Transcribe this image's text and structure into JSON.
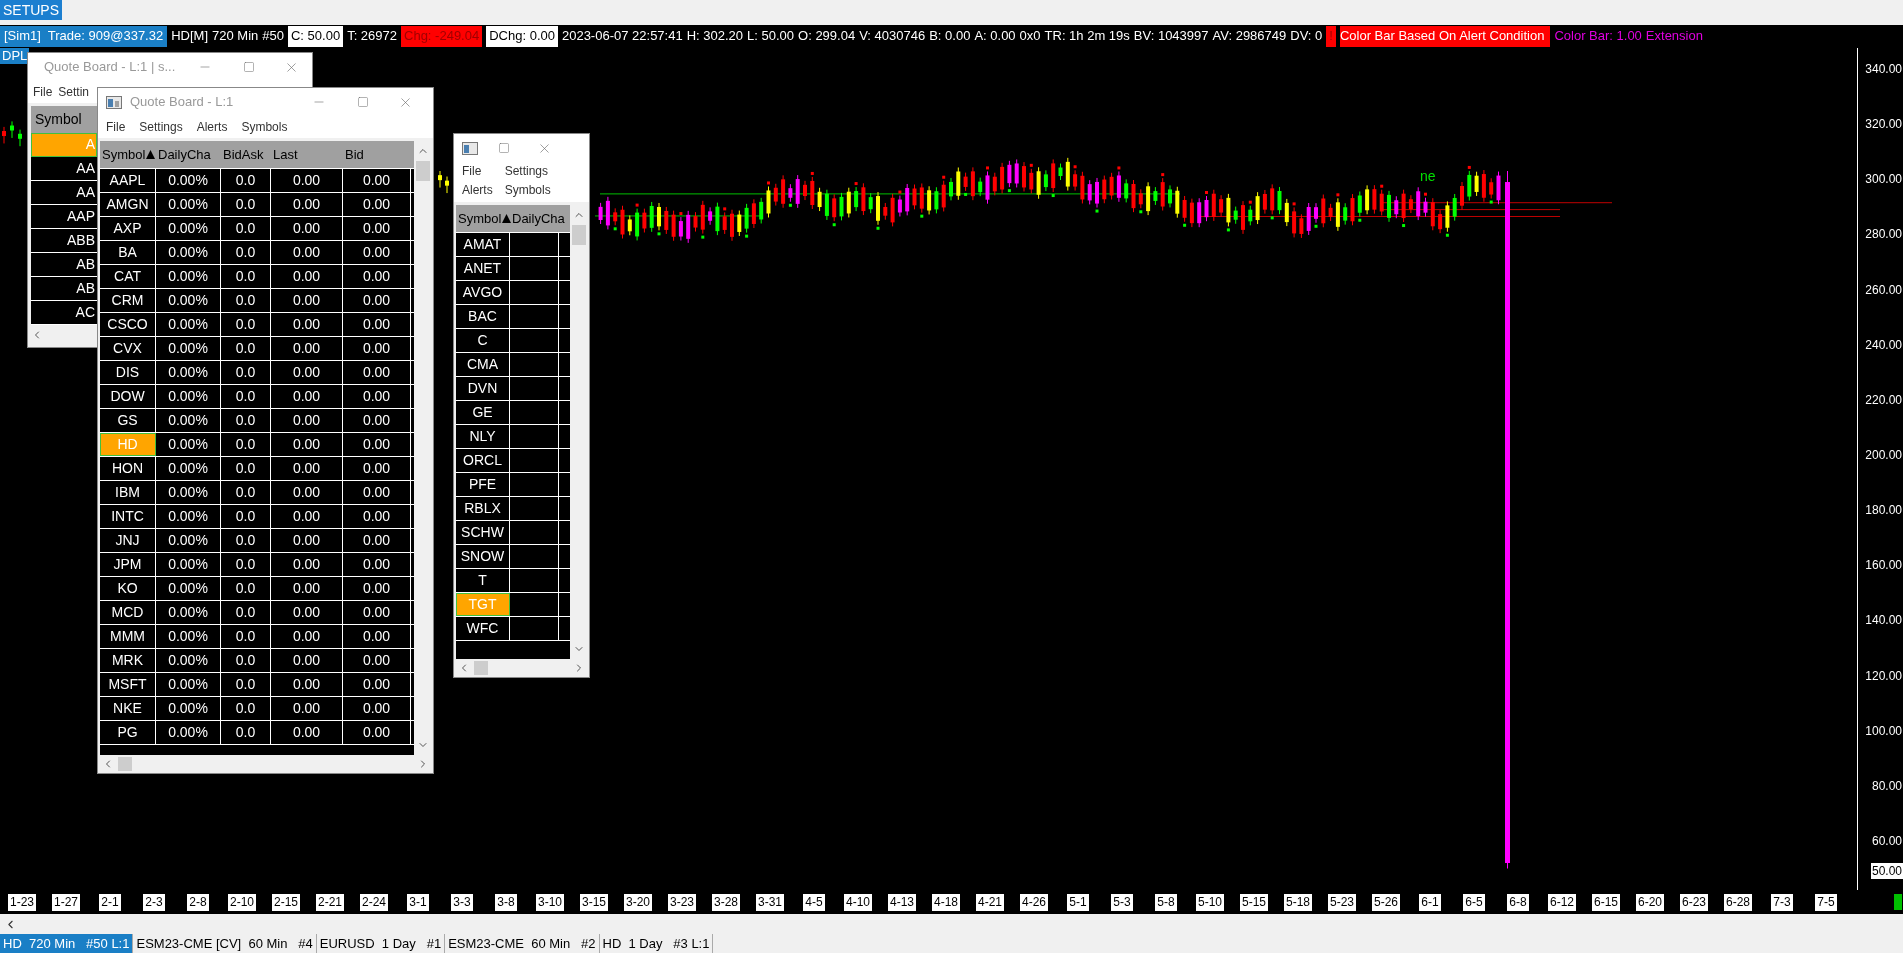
{
  "setups_button": "SETUPS",
  "info_bar": [
    {
      "text": "[Sim1]  Trade: 909@337.32",
      "kind": "account"
    },
    {
      "text": "HD[M]",
      "kind": "plain"
    },
    {
      "text": "720 Min",
      "kind": "plain"
    },
    {
      "text": "#50",
      "kind": "plain"
    },
    {
      "text": "C: 50.00",
      "kind": "boxed"
    },
    {
      "text": "T: 26972",
      "kind": "plain"
    },
    {
      "text": "Chg: -249.04",
      "kind": "alert"
    },
    {
      "text": "DChg: 0.00",
      "kind": "boxed"
    },
    {
      "text": "2023-06-07 22:57:41",
      "kind": "plain"
    },
    {
      "text": "H: 302.20",
      "kind": "plain"
    },
    {
      "text": "L: 50.00",
      "kind": "plain"
    },
    {
      "text": "O: 299.04",
      "kind": "plain"
    },
    {
      "text": "V: 4030746",
      "kind": "plain"
    },
    {
      "text": "B: 0.00",
      "kind": "plain"
    },
    {
      "text": "A: 0.00",
      "kind": "plain"
    },
    {
      "text": "0x0",
      "kind": "plain"
    },
    {
      "text": "TR: 1h 2m 19s",
      "kind": "plain"
    },
    {
      "text": "BV: 1043997",
      "kind": "plain"
    },
    {
      "text": "AV: 2986749",
      "kind": "plain"
    },
    {
      "text": "DV: 0",
      "kind": "plain"
    },
    {
      "text": "!",
      "kind": "alert"
    },
    {
      "text": "Color Bar Based On Alert Condition",
      "kind": "banner"
    },
    {
      "text": "Color Bar: 1.00",
      "kind": "magenta"
    },
    {
      "text": "Extension",
      "kind": "magenta"
    }
  ],
  "indicator_label": "DPL",
  "chart": {
    "annotation": "ne",
    "price_labels": [
      "340.00",
      "320.00",
      "300.00",
      "280.00",
      "260.00",
      "240.00",
      "220.00",
      "200.00",
      "180.00",
      "160.00",
      "140.00",
      "120.00",
      "100.00",
      "80.00",
      "60.00"
    ],
    "last_price": "50.00",
    "date_labels": [
      "1-23",
      "1-27",
      "2-1",
      "2-3",
      "2-8",
      "2-10",
      "2-15",
      "2-21",
      "2-24",
      "3-1",
      "3-3",
      "3-8",
      "3-10",
      "3-15",
      "3-20",
      "3-23",
      "3-28",
      "3-31",
      "4-5",
      "4-10",
      "4-13",
      "4-18",
      "4-21",
      "4-26",
      "5-1",
      "5-3",
      "5-8",
      "5-10",
      "5-15",
      "5-18",
      "5-23",
      "5-26",
      "6-1",
      "6-5",
      "6-8",
      "6-12",
      "6-15",
      "6-20",
      "6-23",
      "6-28",
      "7-3",
      "7-5"
    ]
  },
  "quote_board_back": {
    "title": "Quote Board - L:1 | s...",
    "menu": [
      "File",
      "Settin"
    ],
    "column": "Symbol",
    "rows": [
      {
        "symbol": "A",
        "selected": true
      },
      {
        "symbol": "AA",
        "selected": false
      },
      {
        "symbol": "AA",
        "selected": false
      },
      {
        "symbol": "AAP",
        "selected": false
      },
      {
        "symbol": "ABB",
        "selected": false
      },
      {
        "symbol": "AB",
        "selected": false
      },
      {
        "symbol": "AB",
        "selected": false
      },
      {
        "symbol": "AC",
        "selected": false
      }
    ]
  },
  "quote_board_front": {
    "title": "Quote Board - L:1",
    "menu": [
      "File",
      "Settings",
      "Alerts",
      "Symbols"
    ],
    "columns": [
      "Symbol",
      "DailyCha",
      "BidAsk",
      "Last",
      "Bid"
    ],
    "rows": [
      {
        "symbol": "AAPL",
        "daily_change": "0.00%",
        "bid_ask": "0.0",
        "last": "0.00",
        "bid": "0.00",
        "selected": false
      },
      {
        "symbol": "AMGN",
        "daily_change": "0.00%",
        "bid_ask": "0.0",
        "last": "0.00",
        "bid": "0.00",
        "selected": false
      },
      {
        "symbol": "AXP",
        "daily_change": "0.00%",
        "bid_ask": "0.0",
        "last": "0.00",
        "bid": "0.00",
        "selected": false
      },
      {
        "symbol": "BA",
        "daily_change": "0.00%",
        "bid_ask": "0.0",
        "last": "0.00",
        "bid": "0.00",
        "selected": false
      },
      {
        "symbol": "CAT",
        "daily_change": "0.00%",
        "bid_ask": "0.0",
        "last": "0.00",
        "bid": "0.00",
        "selected": false
      },
      {
        "symbol": "CRM",
        "daily_change": "0.00%",
        "bid_ask": "0.0",
        "last": "0.00",
        "bid": "0.00",
        "selected": false
      },
      {
        "symbol": "CSCO",
        "daily_change": "0.00%",
        "bid_ask": "0.0",
        "last": "0.00",
        "bid": "0.00",
        "selected": false
      },
      {
        "symbol": "CVX",
        "daily_change": "0.00%",
        "bid_ask": "0.0",
        "last": "0.00",
        "bid": "0.00",
        "selected": false
      },
      {
        "symbol": "DIS",
        "daily_change": "0.00%",
        "bid_ask": "0.0",
        "last": "0.00",
        "bid": "0.00",
        "selected": false
      },
      {
        "symbol": "DOW",
        "daily_change": "0.00%",
        "bid_ask": "0.0",
        "last": "0.00",
        "bid": "0.00",
        "selected": false
      },
      {
        "symbol": "GS",
        "daily_change": "0.00%",
        "bid_ask": "0.0",
        "last": "0.00",
        "bid": "0.00",
        "selected": false
      },
      {
        "symbol": "HD",
        "daily_change": "0.00%",
        "bid_ask": "0.0",
        "last": "0.00",
        "bid": "0.00",
        "selected": true
      },
      {
        "symbol": "HON",
        "daily_change": "0.00%",
        "bid_ask": "0.0",
        "last": "0.00",
        "bid": "0.00",
        "selected": false
      },
      {
        "symbol": "IBM",
        "daily_change": "0.00%",
        "bid_ask": "0.0",
        "last": "0.00",
        "bid": "0.00",
        "selected": false
      },
      {
        "symbol": "INTC",
        "daily_change": "0.00%",
        "bid_ask": "0.0",
        "last": "0.00",
        "bid": "0.00",
        "selected": false
      },
      {
        "symbol": "JNJ",
        "daily_change": "0.00%",
        "bid_ask": "0.0",
        "last": "0.00",
        "bid": "0.00",
        "selected": false
      },
      {
        "symbol": "JPM",
        "daily_change": "0.00%",
        "bid_ask": "0.0",
        "last": "0.00",
        "bid": "0.00",
        "selected": false
      },
      {
        "symbol": "KO",
        "daily_change": "0.00%",
        "bid_ask": "0.0",
        "last": "0.00",
        "bid": "0.00",
        "selected": false
      },
      {
        "symbol": "MCD",
        "daily_change": "0.00%",
        "bid_ask": "0.0",
        "last": "0.00",
        "bid": "0.00",
        "selected": false
      },
      {
        "symbol": "MMM",
        "daily_change": "0.00%",
        "bid_ask": "0.0",
        "last": "0.00",
        "bid": "0.00",
        "selected": false
      },
      {
        "symbol": "MRK",
        "daily_change": "0.00%",
        "bid_ask": "0.0",
        "last": "0.00",
        "bid": "0.00",
        "selected": false
      },
      {
        "symbol": "MSFT",
        "daily_change": "0.00%",
        "bid_ask": "0.0",
        "last": "0.00",
        "bid": "0.00",
        "selected": false
      },
      {
        "symbol": "NKE",
        "daily_change": "0.00%",
        "bid_ask": "0.0",
        "last": "0.00",
        "bid": "0.00",
        "selected": false
      },
      {
        "symbol": "PG",
        "daily_change": "0.00%",
        "bid_ask": "0.0",
        "last": "0.00",
        "bid": "0.00",
        "selected": false
      }
    ]
  },
  "quote_board_small": {
    "menu": [
      "File",
      "Settings",
      "Alerts",
      "Symbols"
    ],
    "columns": [
      "Symbol",
      "DailyCha"
    ],
    "rows": [
      {
        "symbol": "AMAT",
        "selected": false
      },
      {
        "symbol": "ANET",
        "selected": false
      },
      {
        "symbol": "AVGO",
        "selected": false
      },
      {
        "symbol": "BAC",
        "selected": false
      },
      {
        "symbol": "C",
        "selected": false
      },
      {
        "symbol": "CMA",
        "selected": false
      },
      {
        "symbol": "DVN",
        "selected": false
      },
      {
        "symbol": "GE",
        "selected": false
      },
      {
        "symbol": "NLY",
        "selected": false
      },
      {
        "symbol": "ORCL",
        "selected": false
      },
      {
        "symbol": "PFE",
        "selected": false
      },
      {
        "symbol": "RBLX",
        "selected": false
      },
      {
        "symbol": "SCHW",
        "selected": false
      },
      {
        "symbol": "SNOW",
        "selected": false
      },
      {
        "symbol": "T",
        "selected": false
      },
      {
        "symbol": "TGT",
        "selected": true
      },
      {
        "symbol": "WFC",
        "selected": false
      }
    ]
  },
  "tabs": [
    {
      "label": "HD  720 Min   #50 L:1",
      "selected": true
    },
    {
      "label": "ESM23-CME [CV]  60 Min   #4",
      "selected": false
    },
    {
      "label": "EURUSD  1 Day   #1",
      "selected": false
    },
    {
      "label": "ESM23-CME  60 Min   #2",
      "selected": false
    },
    {
      "label": "HD  1 Day   #3 L:1",
      "selected": false
    }
  ]
}
